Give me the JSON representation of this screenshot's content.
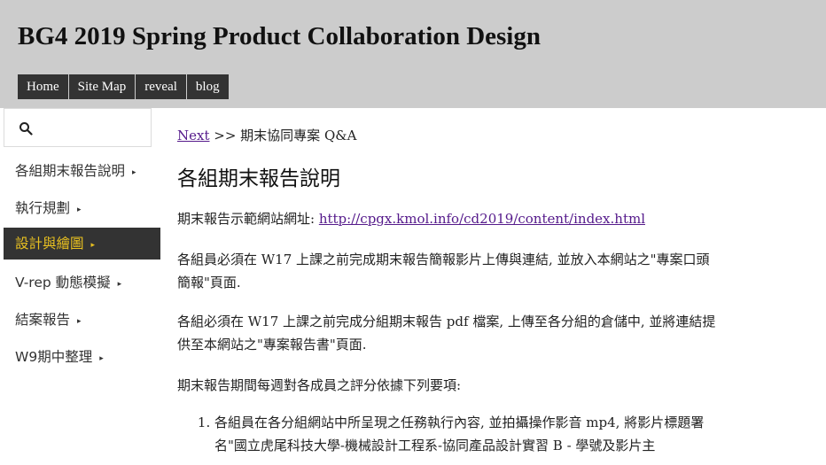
{
  "header": {
    "title": "BG4 2019 Spring Product Collaboration Design",
    "nav": [
      "Home",
      "Site Map",
      "reveal",
      "blog"
    ]
  },
  "sidebar": {
    "search_icon": "search-icon",
    "items": [
      {
        "label": "各組期末報告說明",
        "caret": "▸",
        "active": false
      },
      {
        "label": "執行規劃",
        "caret": "▸",
        "active": false
      },
      {
        "label": "設計與繪圖",
        "caret": "▸",
        "active": true
      },
      {
        "label": "V-rep 動態模擬",
        "caret": "▸",
        "active": false
      },
      {
        "label": "結案報告",
        "caret": "▸",
        "active": false
      },
      {
        "label": "W9期中整理",
        "caret": "▸",
        "active": false
      }
    ]
  },
  "main": {
    "breadcrumb": {
      "link": "Next",
      "text": " >> 期末協同專案 Q&A"
    },
    "title": "各組期末報告說明",
    "example_label": "期末報告示範網站網址: ",
    "example_url": "http://cpgx.kmol.info/cd2019/content/index.html",
    "para1": "各組員必須在 W17 上課之前完成期末報告簡報影片上傳與連結, 並放入本網站之\"專案口頭簡報\"頁面.",
    "para2": "各組必須在 W17 上課之前完成分組期末報告 pdf 檔案, 上傳至各分組的倉儲中, 並將連結提供至本網站之\"專案報告書\"頁面.",
    "para3": "期末報告期間每週對各成員之評分依據下列要項:",
    "list_items": [
      "各組員在各分組網站中所呈現之任務執行內容, 並拍攝操作影音 mp4, 將影片標題署名\"國立虎尾科技大學-機械設計工程系-協同產品設計實習 B - 學號及影片主"
    ]
  },
  "colors": {
    "header_bg": "#cccccc",
    "nav_bg": "#333333",
    "active_text": "#e8c020",
    "link": "#551a8b"
  }
}
